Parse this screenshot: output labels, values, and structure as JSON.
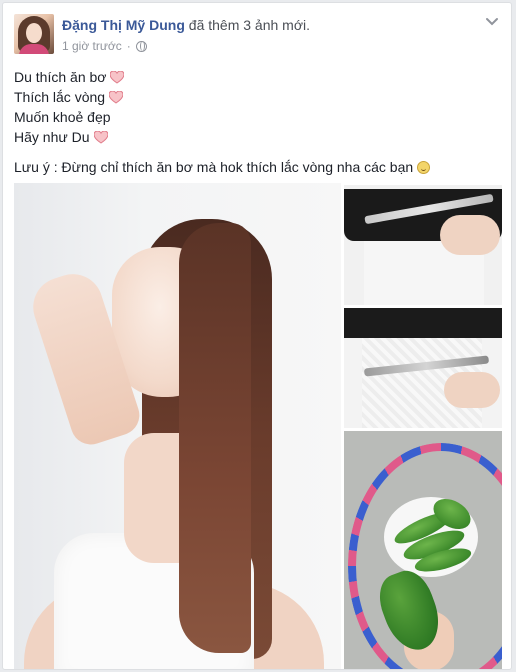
{
  "post": {
    "author": "Đặng Thị Mỹ Dung",
    "action": " đã thêm 3 ảnh mới.",
    "timestamp": "1 giờ trước",
    "separator": "·",
    "lines": [
      {
        "text": "Du thích ăn bơ",
        "emoji": "heart-icon"
      },
      {
        "text": "Thích lắc vòng",
        "emoji": "heart-icon"
      },
      {
        "text": "Muốn khoẻ đẹp",
        "emoji": ""
      },
      {
        "text": "Hãy như Du",
        "emoji": "heart-icon"
      }
    ],
    "note": "Lưu ý : Đừng chỉ thích ăn bơ mà hok thích lắc vòng nha các bạn",
    "note_emoji": "smiley-icon"
  },
  "photos": [
    {
      "name": "main-photo",
      "subject": "woman with long hair touching face"
    },
    {
      "name": "photo-waist-measure-1",
      "subject": "measuring tape around waist"
    },
    {
      "name": "photo-waist-measure-2",
      "subject": "measuring tape around hips"
    },
    {
      "name": "photo-hoop-avocados",
      "subject": "hula hoop with plate of avocados"
    }
  ],
  "colors": {
    "author": "#3b5998",
    "text": "#1d2129",
    "meta": "#90949c",
    "heart": "#f28b97"
  }
}
